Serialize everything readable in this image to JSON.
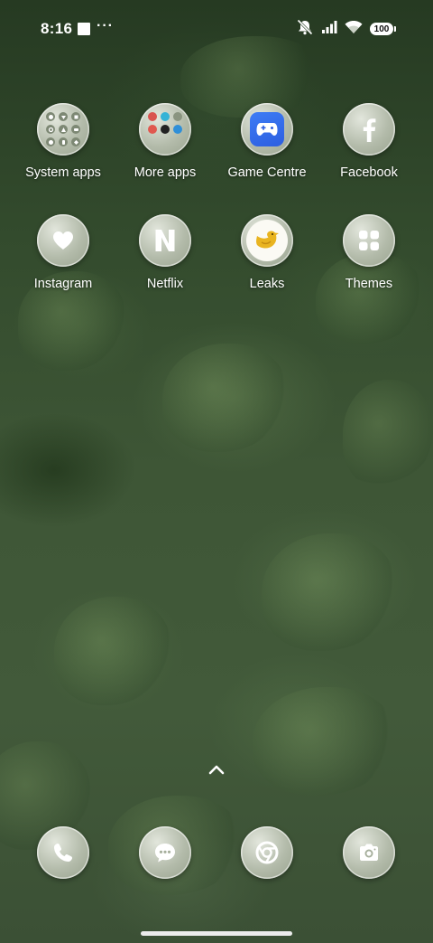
{
  "status_bar": {
    "time": "8:16",
    "more_dots": "···",
    "battery_level": "100",
    "icons": [
      "notification-square-icon",
      "mute-icon",
      "signal-icon",
      "wifi-icon",
      "battery-icon"
    ]
  },
  "home": {
    "apps": [
      {
        "label": "System apps",
        "icon": "folder-icon"
      },
      {
        "label": "More apps",
        "icon": "folder-icon"
      },
      {
        "label": "Game Centre",
        "icon": "gamepad-icon"
      },
      {
        "label": "Facebook",
        "icon": "facebook-icon"
      },
      {
        "label": "Instagram",
        "icon": "heart-icon"
      },
      {
        "label": "Netflix",
        "icon": "netflix-n-icon"
      },
      {
        "label": "Leaks",
        "icon": "bird-icon"
      },
      {
        "label": "Themes",
        "icon": "themes-grid-icon"
      }
    ]
  },
  "app_drawer_hint": {
    "icon": "chevron-up-icon"
  },
  "dock": {
    "apps": [
      {
        "name": "Phone",
        "icon": "phone-icon"
      },
      {
        "name": "Messages",
        "icon": "message-icon"
      },
      {
        "name": "Chrome",
        "icon": "chrome-icon"
      },
      {
        "name": "Camera",
        "icon": "camera-icon"
      }
    ]
  },
  "colors": {
    "icon_background": "#b3bbaa",
    "icon_glyph": "#ffffff",
    "game_centre_blue": "#3d7cf5",
    "leaks_bird": "#e9b420",
    "wallpaper": "#334b2d"
  }
}
